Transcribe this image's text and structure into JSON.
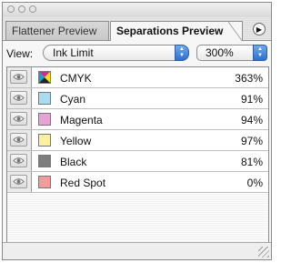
{
  "tabs": [
    {
      "label": "Flattener Preview"
    },
    {
      "label": "Separations Preview"
    }
  ],
  "view": {
    "label": "View:",
    "mode": "Ink Limit",
    "limit": "300%"
  },
  "inks": [
    {
      "name": "CMYK",
      "value": "363%",
      "color": "multi"
    },
    {
      "name": "Cyan",
      "value": "91%",
      "color": "#a9dcf2"
    },
    {
      "name": "Magenta",
      "value": "94%",
      "color": "#e9a2d6"
    },
    {
      "name": "Yellow",
      "value": "97%",
      "color": "#fbf0a0"
    },
    {
      "name": "Black",
      "value": "81%",
      "color": "#7d7d7d"
    },
    {
      "name": "Red Spot",
      "value": "0%",
      "color": "#f29b9b"
    }
  ]
}
